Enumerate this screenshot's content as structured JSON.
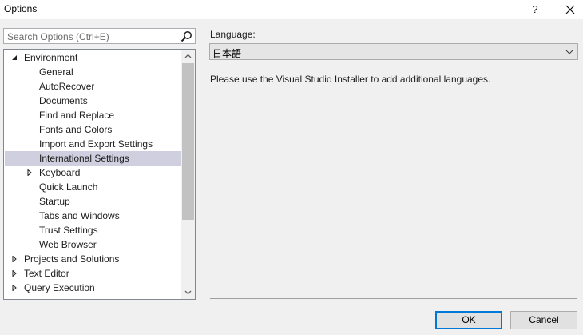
{
  "window": {
    "title": "Options",
    "help_glyph": "?"
  },
  "search": {
    "placeholder": "Search Options (Ctrl+E)"
  },
  "tree": {
    "items": [
      {
        "label": "Environment",
        "level": 0,
        "expander": "expanded"
      },
      {
        "label": "General",
        "level": 1,
        "expander": "none"
      },
      {
        "label": "AutoRecover",
        "level": 1,
        "expander": "none"
      },
      {
        "label": "Documents",
        "level": 1,
        "expander": "none"
      },
      {
        "label": "Find and Replace",
        "level": 1,
        "expander": "none"
      },
      {
        "label": "Fonts and Colors",
        "level": 1,
        "expander": "none"
      },
      {
        "label": "Import and Export Settings",
        "level": 1,
        "expander": "none"
      },
      {
        "label": "International Settings",
        "level": 1,
        "expander": "none",
        "selected": true
      },
      {
        "label": "Keyboard",
        "level": 1,
        "expander": "collapsed"
      },
      {
        "label": "Quick Launch",
        "level": 1,
        "expander": "none"
      },
      {
        "label": "Startup",
        "level": 1,
        "expander": "none"
      },
      {
        "label": "Tabs and Windows",
        "level": 1,
        "expander": "none"
      },
      {
        "label": "Trust Settings",
        "level": 1,
        "expander": "none"
      },
      {
        "label": "Web Browser",
        "level": 1,
        "expander": "none"
      },
      {
        "label": "Projects and Solutions",
        "level": 0,
        "expander": "collapsed"
      },
      {
        "label": "Text Editor",
        "level": 0,
        "expander": "collapsed"
      },
      {
        "label": "Query Execution",
        "level": 0,
        "expander": "collapsed"
      }
    ]
  },
  "panel": {
    "language_label": "Language:",
    "language_value": "日本語",
    "note": "Please use the Visual Studio Installer to add additional languages."
  },
  "buttons": {
    "ok": "OK",
    "cancel": "Cancel"
  },
  "colors": {
    "selection": "#cfcfdf",
    "ok_border": "#0078d7"
  }
}
